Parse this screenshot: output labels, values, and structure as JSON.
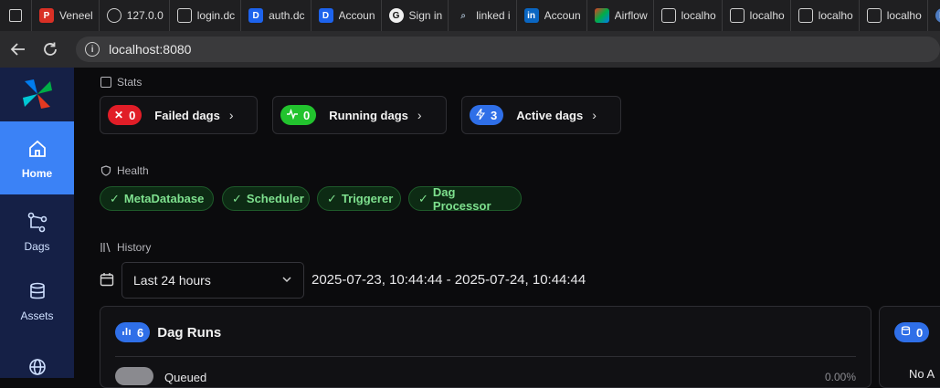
{
  "browser": {
    "tabs": [
      {
        "label": "Veneel",
        "icon": "pdf-icon",
        "color": "#d93025"
      },
      {
        "label": "127.0.0",
        "icon": "globe-icon",
        "color": "#555"
      },
      {
        "label": "login.dc",
        "icon": "file-icon",
        "color": "#666"
      },
      {
        "label": "auth.dc",
        "icon": "docker-icon",
        "color": "#1d63ed"
      },
      {
        "label": "Accoun",
        "icon": "docker-icon",
        "color": "#1d63ed"
      },
      {
        "label": "Sign in",
        "icon": "github-icon",
        "color": "#444"
      },
      {
        "label": "linked i",
        "icon": "search-icon",
        "color": "#333"
      },
      {
        "label": "Accoun",
        "icon": "linkedin-icon",
        "color": "#0a66c2"
      },
      {
        "label": "Airflow",
        "icon": "airflow-icon",
        "color": "#017cee"
      },
      {
        "label": "localho",
        "icon": "file-icon",
        "color": "#666"
      },
      {
        "label": "localho",
        "icon": "file-icon",
        "color": "#666"
      },
      {
        "label": "localho",
        "icon": "file-icon",
        "color": "#666"
      },
      {
        "label": "localho",
        "icon": "file-icon",
        "color": "#666"
      },
      {
        "label": "",
        "icon": "keycloak-icon",
        "color": "#4d7cc2"
      }
    ],
    "url": "localhost:8080"
  },
  "sidebar": {
    "items": [
      {
        "label": "Home",
        "icon": "home-icon",
        "active": true
      },
      {
        "label": "Dags",
        "icon": "dags-icon",
        "active": false
      },
      {
        "label": "Assets",
        "icon": "database-icon",
        "active": false
      },
      {
        "label": "",
        "icon": "globe-icon",
        "active": false
      }
    ]
  },
  "stats": {
    "label": "Stats",
    "cards": [
      {
        "count": "0",
        "label": "Failed dags",
        "icon": "x-icon",
        "color": "#e11d27"
      },
      {
        "count": "0",
        "label": "Running dags",
        "icon": "activity-icon",
        "color": "#22c32e"
      },
      {
        "count": "3",
        "label": "Active dags",
        "icon": "bolt-icon",
        "color": "#2f6fe8"
      }
    ]
  },
  "health": {
    "label": "Health",
    "items": [
      "MetaDatabase",
      "Scheduler",
      "Triggerer",
      "Dag Processor"
    ]
  },
  "history": {
    "label": "History",
    "range_select": "Last 24 hours",
    "date_range": "2025-07-23, 10:44:44 - 2025-07-24, 10:44:44",
    "dag_runs": {
      "count": "6",
      "title": "Dag Runs",
      "row_label": "Queued",
      "row_pct": "0.00%"
    },
    "assets": {
      "count": "0",
      "title": "No A"
    }
  }
}
